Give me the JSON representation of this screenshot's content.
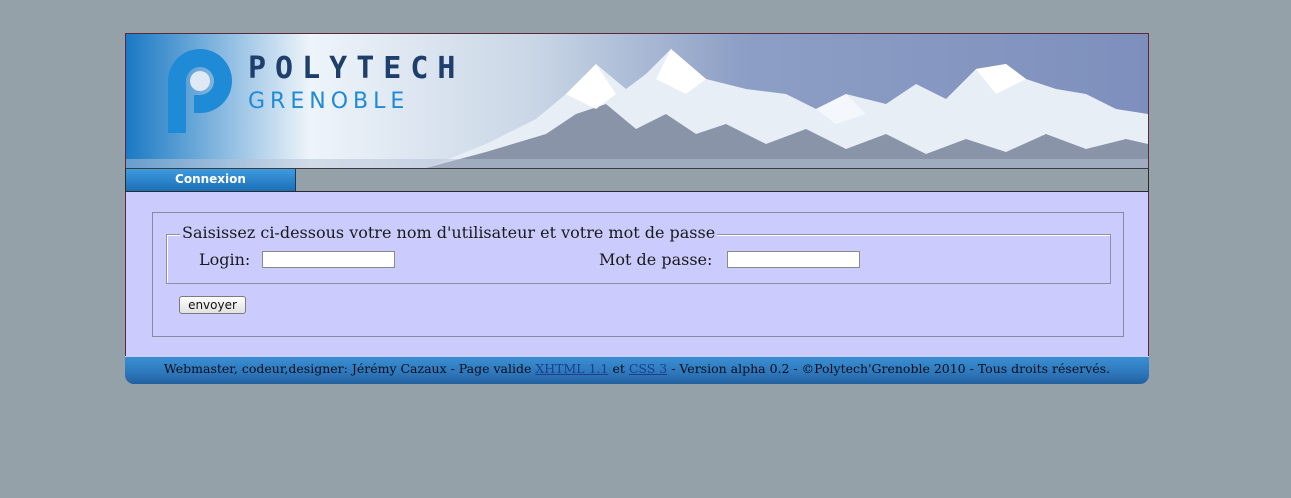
{
  "header": {
    "logo_line1": "POLYTECH",
    "logo_line2": "GRENOBLE"
  },
  "nav": {
    "tabs": [
      {
        "label": "Connexion",
        "active": true
      }
    ]
  },
  "form": {
    "legend": "Saisissez ci-dessous votre nom d'utilisateur et votre mot de passe",
    "login_label": "Login:",
    "login_value": "",
    "password_label": "Mot de passe:",
    "password_value": "",
    "submit_label": "envoyer"
  },
  "footer": {
    "text_before": "Webmaster, codeur,designer: Jérémy Cazaux - Page valide ",
    "link_xhtml": "XHTML 1.1",
    "text_and": " et ",
    "link_css": "CSS 3",
    "text_after": " - Version alpha 0.2  - ©Polytech'Grenoble 2010 - Tous droits réservés."
  },
  "colors": {
    "background": "#95a1a8",
    "panel": "#cbcbfd",
    "accent_blue": "#1f8ad6",
    "logo_dark": "#1e3f6b",
    "footer_blue": "#2f79bd"
  }
}
